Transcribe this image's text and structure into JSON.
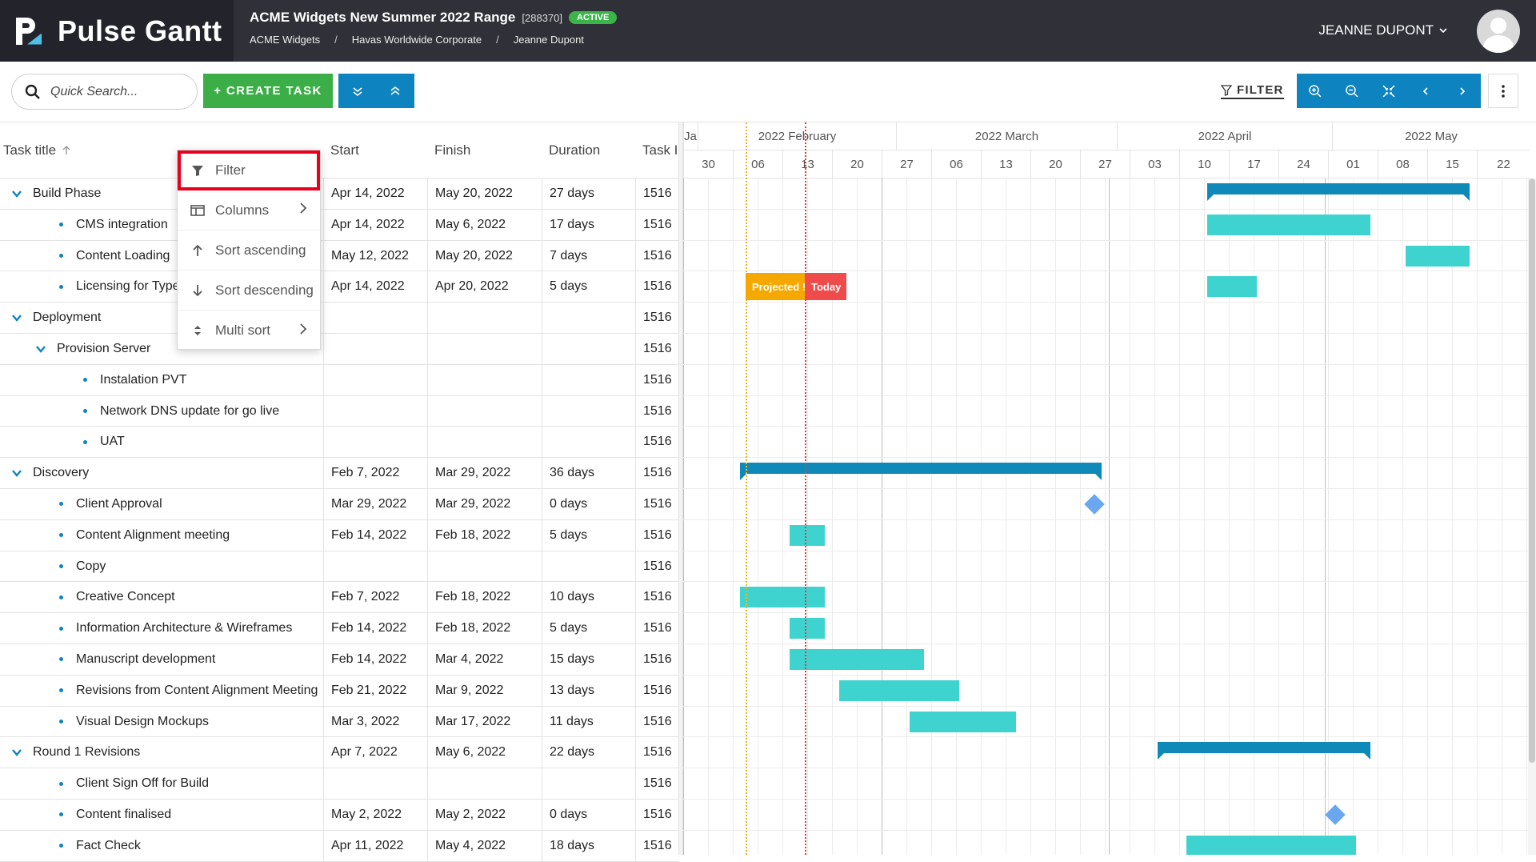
{
  "app": {
    "name": "Pulse Gantt"
  },
  "project": {
    "title": "ACME Widgets New Summer 2022 Range",
    "id": "[288370]",
    "status": "ACTIVE",
    "breadcrumbs": [
      "ACME Widgets",
      "Havas Worldwide Corporate",
      "Jeanne Dupont"
    ]
  },
  "user": {
    "name": "JEANNE DUPONT"
  },
  "toolbar": {
    "search_placeholder": "Quick Search...",
    "create_label": "+ CREATE TASK",
    "filter_label": "FILTER"
  },
  "columns": {
    "title": "Task title",
    "start": "Start",
    "finish": "Finish",
    "duration": "Duration",
    "task_num": "Task I"
  },
  "menu": {
    "items": [
      "Filter",
      "Columns",
      "Sort ascending",
      "Sort descending",
      "Multi sort"
    ]
  },
  "timeline": {
    "months": [
      "Ja",
      "2022 February",
      "2022 March",
      "2022 April",
      "2022 May"
    ],
    "weeks": [
      "30",
      "06",
      "13",
      "20",
      "27",
      "06",
      "13",
      "20",
      "27",
      "03",
      "10",
      "17",
      "24",
      "01",
      "08",
      "15",
      "22"
    ],
    "projected_label": "Projected !",
    "today_label": "Today"
  },
  "rows": [
    {
      "title": "Build Phase",
      "level": 0,
      "group": true,
      "start": "Apr 14, 2022",
      "finish": "May 20, 2022",
      "duration": "27 days",
      "num": "1516"
    },
    {
      "title": "CMS integration",
      "level": 1,
      "group": false,
      "start": "Apr 14, 2022",
      "finish": "May 6, 2022",
      "duration": "17 days",
      "num": "1516"
    },
    {
      "title": "Content Loading",
      "level": 1,
      "group": false,
      "start": "May 12, 2022",
      "finish": "May 20, 2022",
      "duration": "7 days",
      "num": "1516"
    },
    {
      "title": "Licensing for Typefaces",
      "level": 1,
      "group": false,
      "start": "Apr 14, 2022",
      "finish": "Apr 20, 2022",
      "duration": "5 days",
      "num": "1516"
    },
    {
      "title": "Deployment",
      "level": 0,
      "group": true,
      "start": "",
      "finish": "",
      "duration": "",
      "num": "1516"
    },
    {
      "title": "Provision Server",
      "level": 1,
      "group": true,
      "start": "",
      "finish": "",
      "duration": "",
      "num": "1516"
    },
    {
      "title": "Instalation PVT",
      "level": 2,
      "group": false,
      "start": "",
      "finish": "",
      "duration": "",
      "num": "1516"
    },
    {
      "title": "Network DNS update for go live",
      "level": 2,
      "group": false,
      "start": "",
      "finish": "",
      "duration": "",
      "num": "1516"
    },
    {
      "title": "UAT",
      "level": 2,
      "group": false,
      "start": "",
      "finish": "",
      "duration": "",
      "num": "1516"
    },
    {
      "title": "Discovery",
      "level": 0,
      "group": true,
      "start": "Feb 7, 2022",
      "finish": "Mar 29, 2022",
      "duration": "36 days",
      "num": "1516"
    },
    {
      "title": "Client Approval",
      "level": 1,
      "group": false,
      "start": "Mar 29, 2022",
      "finish": "Mar 29, 2022",
      "duration": "0 days",
      "num": "1516"
    },
    {
      "title": "Content Alignment meeting",
      "level": 1,
      "group": false,
      "start": "Feb 14, 2022",
      "finish": "Feb 18, 2022",
      "duration": "5 days",
      "num": "1516"
    },
    {
      "title": "Copy",
      "level": 1,
      "group": false,
      "start": "",
      "finish": "",
      "duration": "",
      "num": "1516"
    },
    {
      "title": "Creative Concept",
      "level": 1,
      "group": false,
      "start": "Feb 7, 2022",
      "finish": "Feb 18, 2022",
      "duration": "10 days",
      "num": "1516"
    },
    {
      "title": "Information Architecture & Wireframes",
      "level": 1,
      "group": false,
      "start": "Feb 14, 2022",
      "finish": "Feb 18, 2022",
      "duration": "5 days",
      "num": "1516"
    },
    {
      "title": "Manuscript development",
      "level": 1,
      "group": false,
      "start": "Feb 14, 2022",
      "finish": "Mar 4, 2022",
      "duration": "15 days",
      "num": "1516"
    },
    {
      "title": "Revisions from Content Alignment Meeting",
      "level": 1,
      "group": false,
      "start": "Feb 21, 2022",
      "finish": "Mar 9, 2022",
      "duration": "13 days",
      "num": "1516"
    },
    {
      "title": "Visual Design Mockups",
      "level": 1,
      "group": false,
      "start": "Mar 3, 2022",
      "finish": "Mar 17, 2022",
      "duration": "11 days",
      "num": "1516"
    },
    {
      "title": "Round 1 Revisions",
      "level": 0,
      "group": true,
      "start": "Apr 7, 2022",
      "finish": "May 6, 2022",
      "duration": "22 days",
      "num": "1516"
    },
    {
      "title": "Client Sign Off for Build",
      "level": 1,
      "group": false,
      "start": "",
      "finish": "",
      "duration": "",
      "num": "1516"
    },
    {
      "title": "Content finalised",
      "level": 1,
      "group": false,
      "start": "May 2, 2022",
      "finish": "May 2, 2022",
      "duration": "0 days",
      "num": "1516"
    },
    {
      "title": "Fact Check",
      "level": 1,
      "group": false,
      "start": "Apr 11, 2022",
      "finish": "May 4, 2022",
      "duration": "18 days",
      "num": "1516"
    }
  ]
}
